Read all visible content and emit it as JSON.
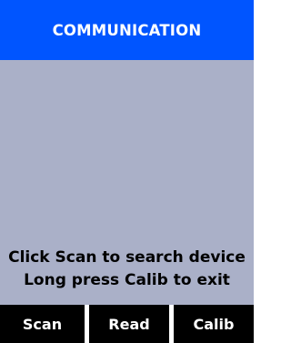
{
  "header": {
    "title": "COMMUNICATION"
  },
  "content": {
    "lines": [
      "Click Scan to search device",
      "Long press Calib to exit"
    ]
  },
  "softkeys": {
    "left": "Scan",
    "middle": "Read",
    "right": "Calib"
  },
  "colors": {
    "header": "#0055ff",
    "content": "#aab0c8",
    "softkey": "#000000"
  }
}
